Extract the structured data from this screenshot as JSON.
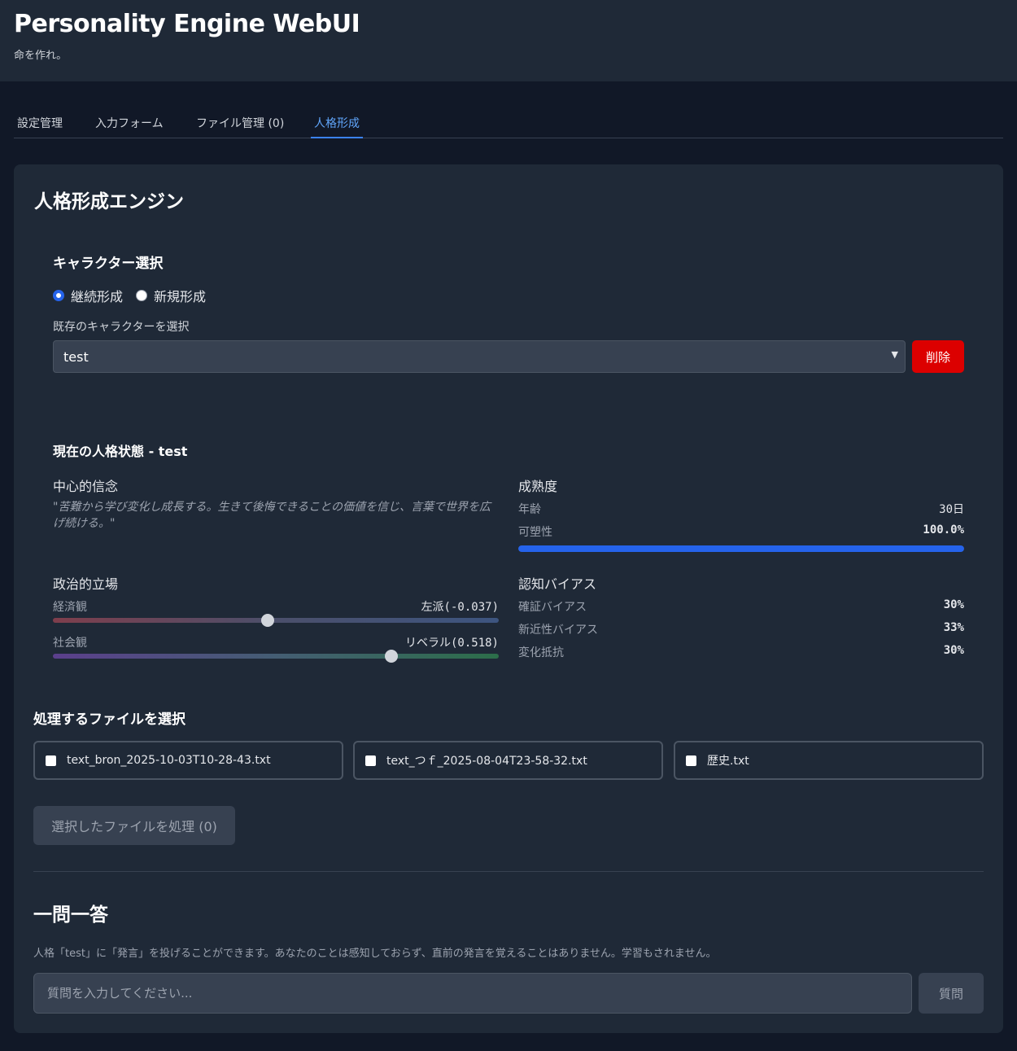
{
  "app": {
    "title": "Personality Engine WebUI",
    "subtitle": "命を作れ。"
  },
  "tabs": [
    {
      "label": "設定管理",
      "active": false
    },
    {
      "label": "入力フォーム",
      "active": false
    },
    {
      "label": "ファイル管理 (0)",
      "active": false
    },
    {
      "label": "人格形成",
      "active": true
    }
  ],
  "engine": {
    "title": "人格形成エンジン",
    "character_select": {
      "heading": "キャラクター選択",
      "mode_options": [
        {
          "label": "継続形成",
          "checked": true
        },
        {
          "label": "新規形成",
          "checked": false
        }
      ],
      "existing_label": "既存のキャラクターを選択",
      "selected": "test",
      "delete_label": "削除"
    },
    "state": {
      "heading": "現在の人格状態 - test",
      "core_belief_heading": "中心的信念",
      "core_belief": "\"苦難から学び変化し成長する。生きて後悔できることの価値を信じ、言葉で世界を広げ続ける。\"",
      "maturity_heading": "成熟度",
      "age_label": "年齢",
      "age_value": "30日",
      "plasticity_label": "可塑性",
      "plasticity_value": "100.0%",
      "plasticity_fraction": 1.0,
      "political_heading": "政治的立場",
      "economic_label": "経済観",
      "economic_value": "左派(-0.037)",
      "economic_score": -0.037,
      "social_label": "社会観",
      "social_value": "リベラル(0.518)",
      "social_score": 0.518,
      "bias_heading": "認知バイアス",
      "biases": [
        {
          "label": "確証バイアス",
          "value": "30%"
        },
        {
          "label": "新近性バイアス",
          "value": "33%"
        },
        {
          "label": "変化抵抗",
          "value": "30%"
        }
      ]
    },
    "files": {
      "heading": "処理するファイルを選択",
      "items": [
        {
          "name": "text_bron_2025-10-03T10-28-43.txt",
          "checked": false
        },
        {
          "name": "text_つｆ_2025-08-04T23-58-32.txt",
          "checked": false
        },
        {
          "name": "歴史.txt",
          "checked": false
        }
      ],
      "process_label": "選択したファイルを処理 (0)"
    },
    "qa": {
      "title": "一問一答",
      "description": "人格「test」に「発言」を投げることができます。あなたのことは感知しておらず、直前の発言を覚えることはありません。学習もされません。",
      "placeholder": "質問を入力してください...",
      "ask_label": "質問"
    }
  },
  "colors": {
    "background": "#111827",
    "panel": "#1f2937",
    "accent": "#2563eb",
    "danger": "#dc0000"
  }
}
